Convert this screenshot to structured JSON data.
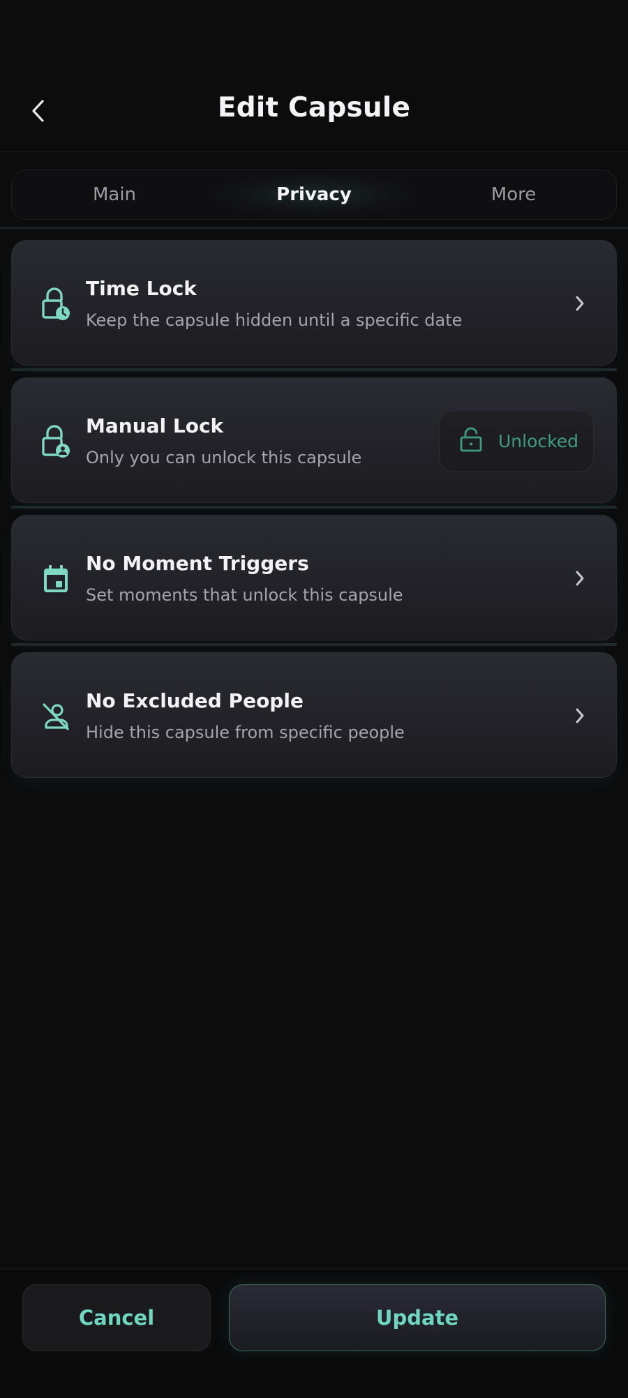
{
  "header": {
    "title": "Edit Capsule"
  },
  "tabs": [
    {
      "label": "Main",
      "active": false
    },
    {
      "label": "Privacy",
      "active": true
    },
    {
      "label": "More",
      "active": false
    }
  ],
  "options": [
    {
      "title": "Time Lock",
      "subtitle": "Keep the capsule hidden until a specific date",
      "icon": "lock-clock-icon"
    },
    {
      "title": "Manual Lock",
      "subtitle": "Only you can unlock this capsule",
      "icon": "lock-person-icon",
      "state": "Unlocked"
    },
    {
      "title": "No Moment Triggers",
      "subtitle": "Set moments that unlock this capsule",
      "icon": "calendar-icon"
    },
    {
      "title": "No Excluded People",
      "subtitle": "Hide this capsule from specific people",
      "icon": "person-off-icon"
    }
  ],
  "footer": {
    "cancel_label": "Cancel",
    "update_label": "Update"
  },
  "colors": {
    "accent": "#7fd8c4",
    "accent_dark": "#3f9c82",
    "background": "#0c0c0d",
    "card": "#25252b"
  }
}
